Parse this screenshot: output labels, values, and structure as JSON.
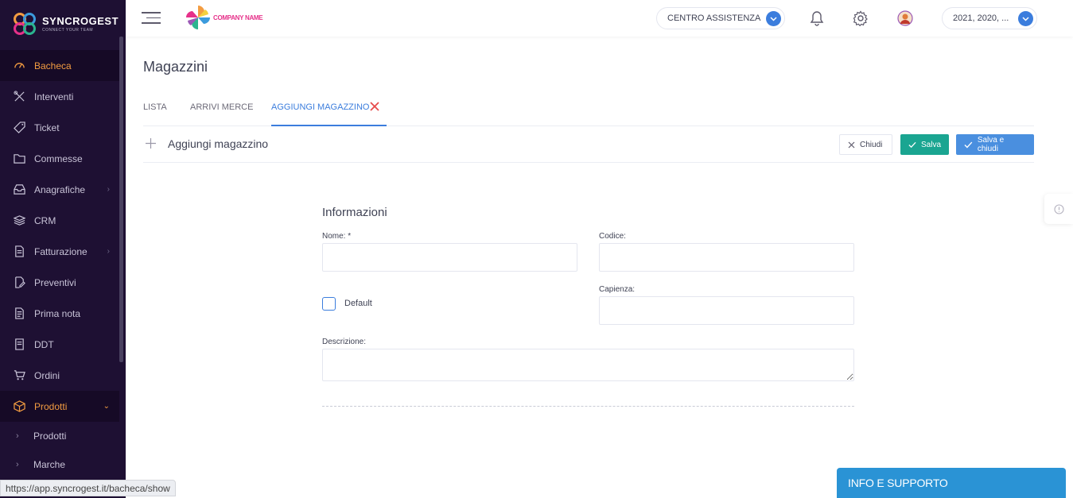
{
  "brand": {
    "name": "SYNCROGEST",
    "tagline": "CONNECT YOUR TEAM",
    "company_logo_text": "COMPANY NAME"
  },
  "sidebar": {
    "items": [
      {
        "label": "Bacheca",
        "icon": "dashboard-gauge-icon",
        "active": true
      },
      {
        "label": "Interventi",
        "icon": "tools-icon"
      },
      {
        "label": "Ticket",
        "icon": "tag-icon"
      },
      {
        "label": "Commesse",
        "icon": "folder-icon"
      },
      {
        "label": "Anagrafiche",
        "icon": "inbox-icon",
        "has_submenu": true
      },
      {
        "label": "CRM",
        "icon": "layers-icon"
      },
      {
        "label": "Fatturazione",
        "icon": "document-icon",
        "has_submenu": true
      },
      {
        "label": "Preventivi",
        "icon": "edit-document-icon"
      },
      {
        "label": "Prima nota",
        "icon": "notes-icon"
      },
      {
        "label": "DDT",
        "icon": "page-icon"
      },
      {
        "label": "Ordini",
        "icon": "cart-icon"
      },
      {
        "label": "Prodotti",
        "icon": "box-icon",
        "expanded": true
      }
    ],
    "subitems": [
      {
        "label": "Prodotti"
      },
      {
        "label": "Marche"
      }
    ]
  },
  "status_url": "https://app.syncrogest.it/bacheca/show",
  "topbar": {
    "assistance_label": "CENTRO ASSISTENZA",
    "years_label": "2021, 2020, ..."
  },
  "page": {
    "title": "Magazzini",
    "tabs": [
      {
        "label": "LISTA"
      },
      {
        "label": "ARRIVI MERCE"
      },
      {
        "label": "AGGIUNGI MAGAZZINO",
        "active": true
      }
    ]
  },
  "card": {
    "title": "Aggiungi magazzino",
    "buttons": {
      "close": "Chiudi",
      "save": "Salva",
      "save_close": "Salva e chiudi"
    }
  },
  "form": {
    "section_title": "Informazioni",
    "fields": {
      "nome": {
        "label": "Nome: *",
        "value": ""
      },
      "codice": {
        "label": "Codice:",
        "value": ""
      },
      "default": {
        "label": "Default",
        "checked": false
      },
      "capienza": {
        "label": "Capienza:",
        "value": ""
      },
      "descrizione": {
        "label": "Descrizione:",
        "value": ""
      }
    }
  },
  "support_label": "INFO E SUPPORTO",
  "colors": {
    "sidebar_bg": "#1e1033",
    "accent_orange": "#f39c41",
    "primary_blue": "#3b7ddd",
    "save_green": "#1aa591",
    "support_blue": "#2a93d5",
    "danger_red": "#e74c4c"
  }
}
